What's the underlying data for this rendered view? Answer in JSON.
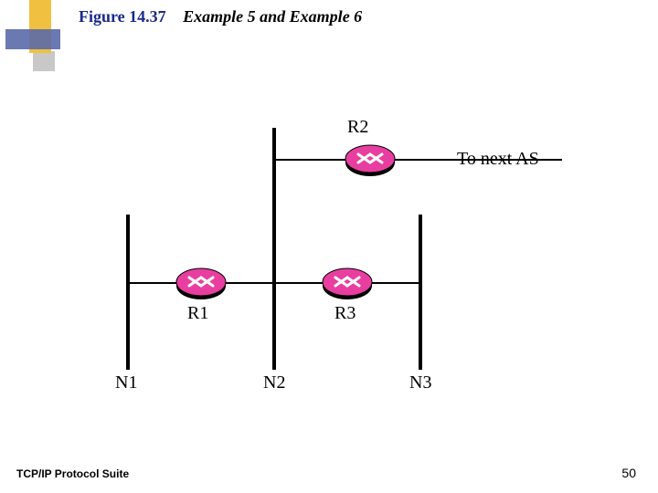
{
  "title": {
    "figure": "Figure 14.37",
    "caption": "Example 5 and Example 6"
  },
  "footer": {
    "left": "TCP/IP Protocol Suite",
    "page": "50"
  },
  "diagram": {
    "routers": {
      "r1": "R1",
      "r2": "R2",
      "r3": "R3"
    },
    "networks": {
      "n1": "N1",
      "n2": "N2",
      "n3": "N3"
    },
    "annotation": "To next AS"
  }
}
